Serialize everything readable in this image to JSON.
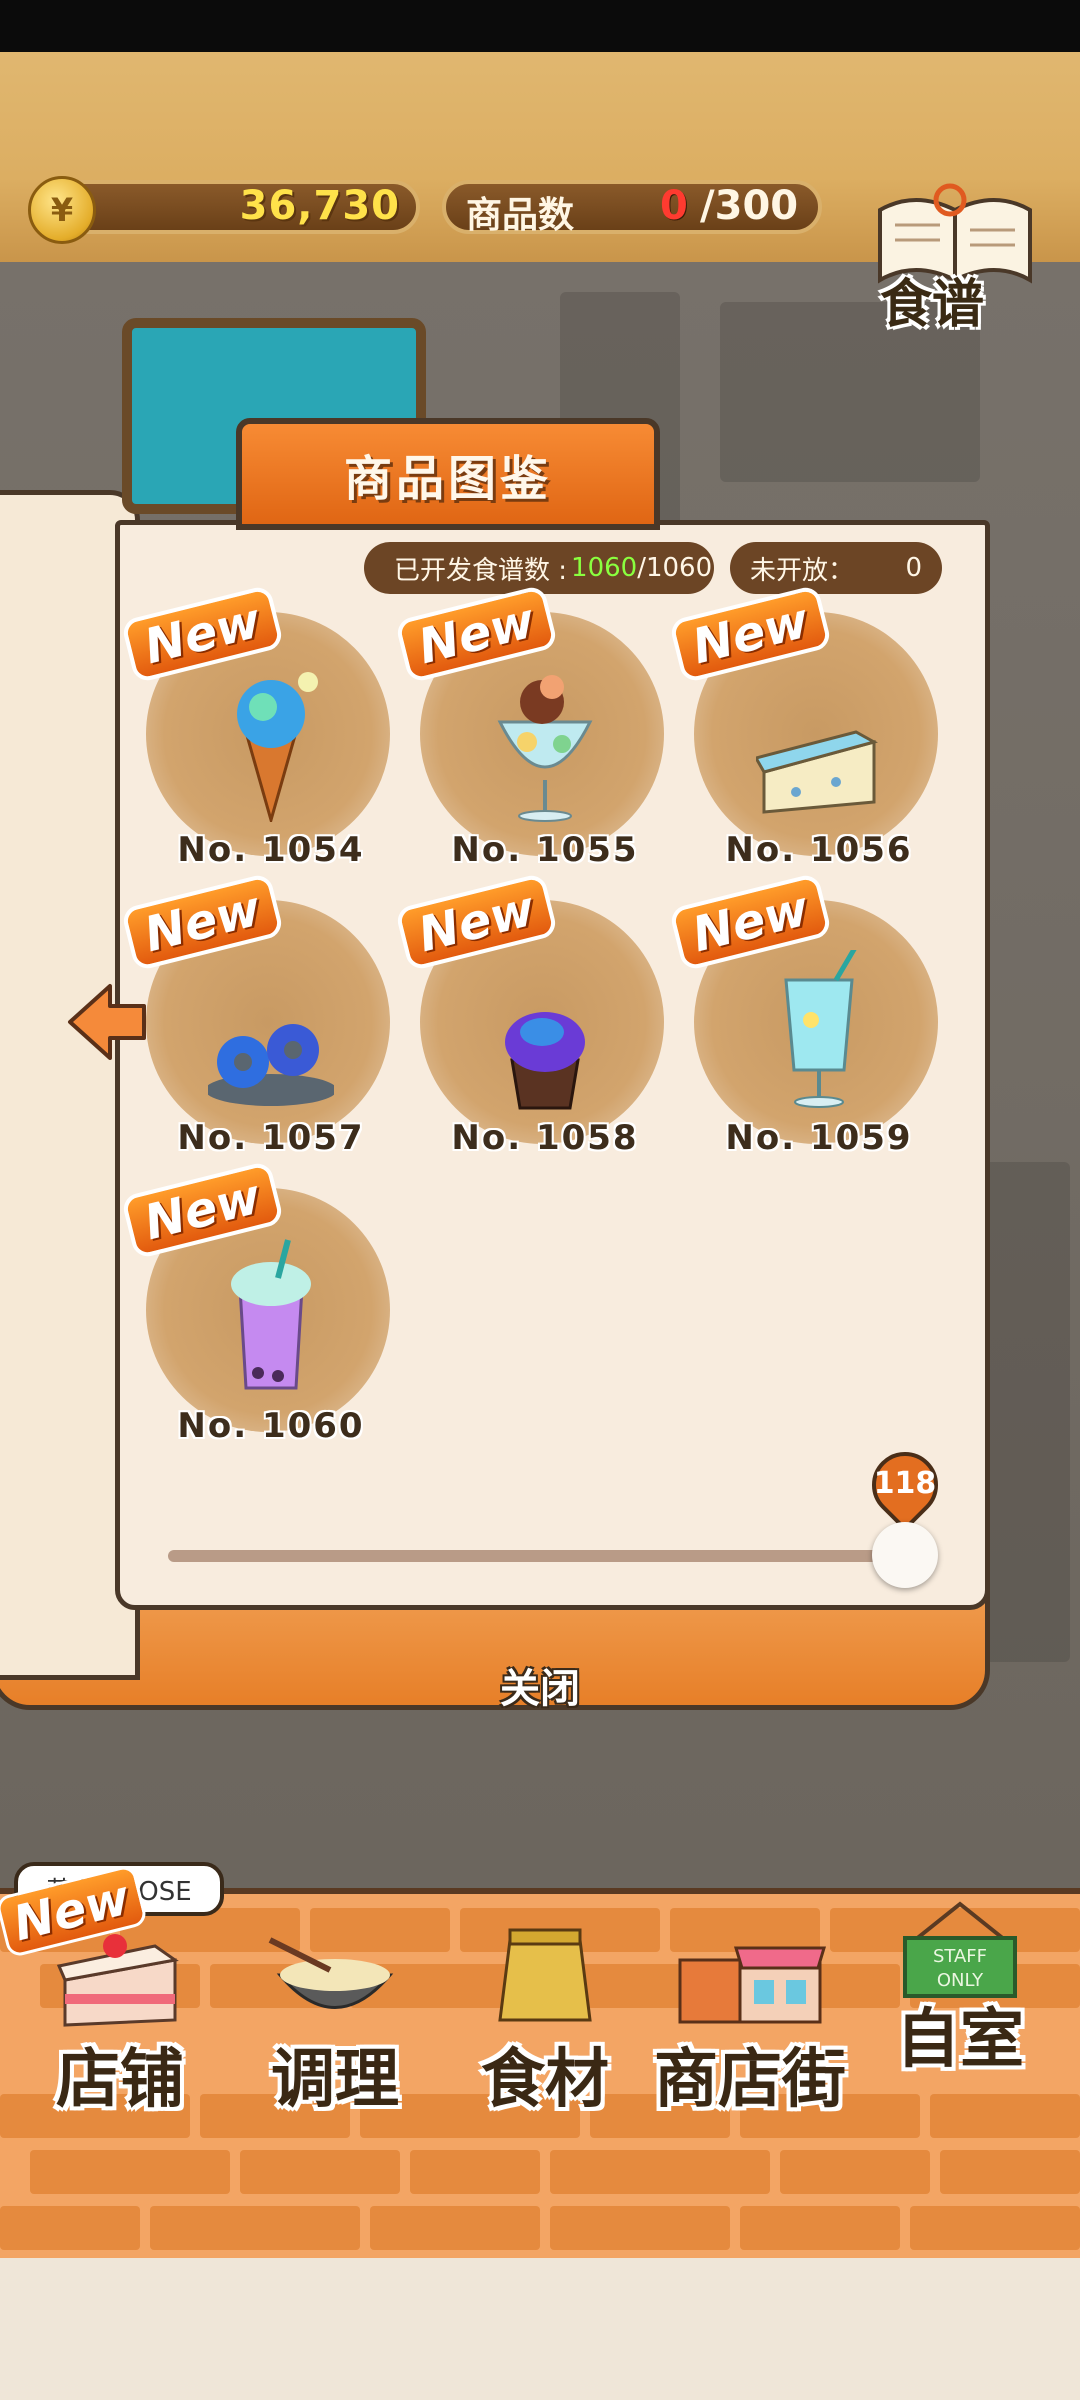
{
  "header": {
    "coin_symbol": "¥",
    "coins": "36,730",
    "items_label": "商品数",
    "items_count": "0",
    "items_total": "/300",
    "recipe_label": "食谱"
  },
  "dialog": {
    "title": "商品图鉴",
    "developed_label": "已开发食谱数 :",
    "developed_value": "1060",
    "developed_total": "/1060",
    "closed_label": "未开放：",
    "closed_value": "0",
    "new_badge": "New",
    "close_label": "关闭",
    "slider_value": "118",
    "products": [
      {
        "no": "No. 1054",
        "icon": "ice-cream-cone-icon"
      },
      {
        "no": "No. 1055",
        "icon": "parfait-glass-icon"
      },
      {
        "no": "No. 1056",
        "icon": "cheesecake-slice-icon"
      },
      {
        "no": "No. 1057",
        "icon": "donuts-plate-icon"
      },
      {
        "no": "No. 1058",
        "icon": "cupcake-icon"
      },
      {
        "no": "No. 1059",
        "icon": "soda-glass-icon"
      },
      {
        "no": "No. 1060",
        "icon": "bubble-tea-icon"
      }
    ]
  },
  "nav": {
    "close_banner": "营业 CLOSE",
    "new_badge": "New",
    "items": [
      {
        "label": "店铺",
        "icon": "cake-icon"
      },
      {
        "label": "调理",
        "icon": "mixing-bowl-icon"
      },
      {
        "label": "食材",
        "icon": "ingredient-bag-icon"
      },
      {
        "label": "商店街",
        "icon": "storefront-icon"
      },
      {
        "label": "自室",
        "icon": "staff-only-sign-icon"
      }
    ],
    "staff_sign": "STAFF ONLY"
  },
  "colors": {
    "accent_orange": "#e06614",
    "coin_text": "#ffe24a",
    "count_red": "#ff3b30",
    "developed_green": "#8aff3f"
  }
}
